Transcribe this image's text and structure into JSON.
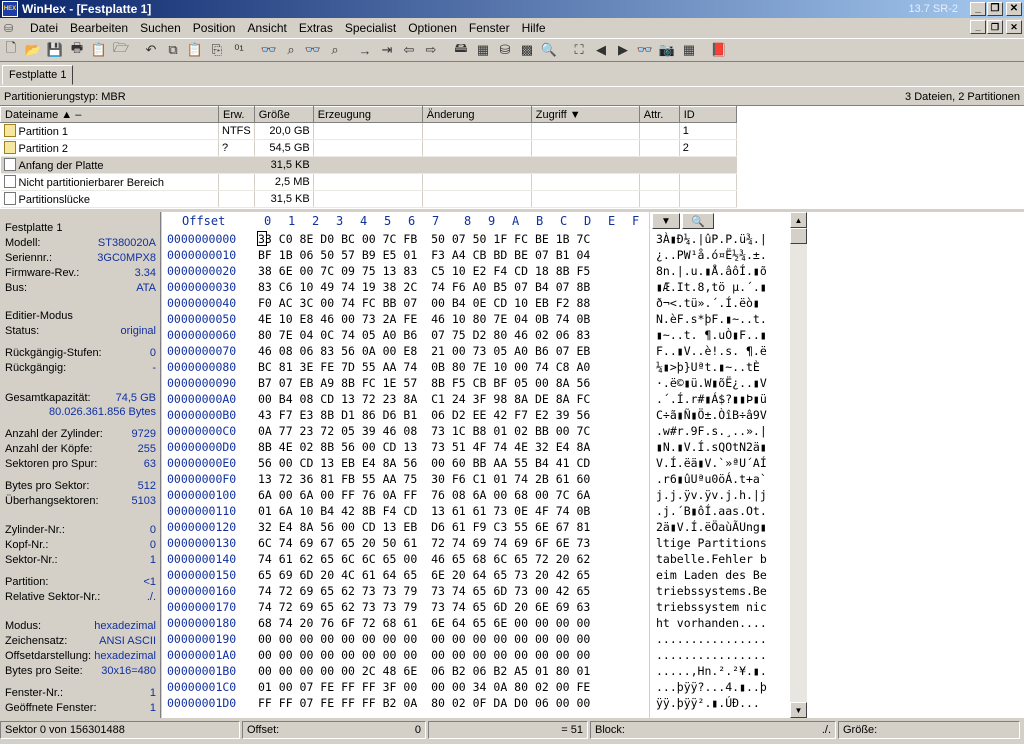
{
  "window": {
    "app_icon_text": "HEX",
    "title": "WinHex - [Festplatte 1]",
    "version": "13.7 SR-2",
    "buttons": [
      "_",
      "❐",
      "✕"
    ]
  },
  "menu": {
    "items": [
      "Datei",
      "Bearbeiten",
      "Suchen",
      "Position",
      "Ansicht",
      "Extras",
      "Specialist",
      "Optionen",
      "Fenster",
      "Hilfe"
    ],
    "mdi_buttons": [
      "_",
      "❐",
      "✕"
    ]
  },
  "toolbar": {
    "icons": [
      {
        "name": "new-icon",
        "glyph": "🗋"
      },
      {
        "name": "open-icon",
        "glyph": "📂"
      },
      {
        "name": "save-icon",
        "glyph": "💾"
      },
      {
        "name": "print-icon",
        "glyph": "🖶"
      },
      {
        "name": "properties-icon",
        "glyph": "📋"
      },
      {
        "name": "open-folder-icon",
        "glyph": "🗁"
      },
      {
        "name": "sep",
        "glyph": ""
      },
      {
        "name": "undo-icon",
        "glyph": "↶"
      },
      {
        "name": "copy-icon",
        "glyph": "⧉"
      },
      {
        "name": "paste-icon",
        "glyph": "📋"
      },
      {
        "name": "paste-special-icon",
        "glyph": "⎘"
      },
      {
        "name": "copy-hex-icon",
        "glyph": "⁰¹"
      },
      {
        "name": "sep",
        "glyph": ""
      },
      {
        "name": "find-text-icon",
        "glyph": "👓"
      },
      {
        "name": "find-hex-icon",
        "glyph": "⌕"
      },
      {
        "name": "replace-text-icon",
        "glyph": "👓"
      },
      {
        "name": "replace-hex-icon",
        "glyph": "⌕"
      },
      {
        "name": "sep",
        "glyph": ""
      },
      {
        "name": "goto-offset-icon",
        "glyph": "→"
      },
      {
        "name": "goto-sector-icon",
        "glyph": "⇥"
      },
      {
        "name": "back-icon",
        "glyph": "⇦"
      },
      {
        "name": "forward-icon",
        "glyph": "⇨"
      },
      {
        "name": "sep",
        "glyph": ""
      },
      {
        "name": "disk-editor-icon",
        "glyph": "🖴"
      },
      {
        "name": "ram-editor-icon",
        "glyph": "▦"
      },
      {
        "name": "disk-clone-icon",
        "glyph": "⛁"
      },
      {
        "name": "calculator-icon",
        "glyph": "▩"
      },
      {
        "name": "search-icon",
        "glyph": "🔍"
      },
      {
        "name": "sep",
        "glyph": ""
      },
      {
        "name": "binoculars-icon",
        "glyph": "⛶"
      },
      {
        "name": "prev-icon",
        "glyph": "◀"
      },
      {
        "name": "next-icon",
        "glyph": "▶"
      },
      {
        "name": "find-next-icon",
        "glyph": "👓"
      },
      {
        "name": "snapshot-icon",
        "glyph": "📷"
      },
      {
        "name": "grid-icon",
        "glyph": "▦"
      },
      {
        "name": "sep",
        "glyph": ""
      },
      {
        "name": "help-book-icon",
        "glyph": "📕"
      }
    ]
  },
  "tabs": [
    {
      "label": "Festplatte 1"
    }
  ],
  "infobar": {
    "left": "Partitionierungstyp: MBR",
    "right": "3 Dateien, 2 Partitionen"
  },
  "filelist": {
    "columns": [
      "Dateiname ▲ –",
      "Erw.",
      "Größe",
      "Erzeugung",
      "Änderung",
      "Zugriff ▼",
      "Attr.",
      "ID"
    ],
    "rows": [
      {
        "name": "Partition 1",
        "ext": "NTFS",
        "size": "20,0 GB",
        "created": "",
        "modified": "",
        "accessed": "",
        "attr": "",
        "id": "1",
        "icon": "part"
      },
      {
        "name": "Partition 2",
        "ext": "?",
        "size": "54,5 GB",
        "created": "",
        "modified": "",
        "accessed": "",
        "attr": "",
        "id": "2",
        "icon": "part"
      },
      {
        "name": "Anfang der Platte",
        "ext": "",
        "size": "31,5 KB",
        "created": "",
        "modified": "",
        "accessed": "",
        "attr": "",
        "id": "",
        "icon": "file",
        "selected": true
      },
      {
        "name": "Nicht partitionierbarer Bereich",
        "ext": "",
        "size": "2,5 MB",
        "created": "",
        "modified": "",
        "accessed": "",
        "attr": "",
        "id": "",
        "icon": "file"
      },
      {
        "name": "Partitionslücke",
        "ext": "",
        "size": "31,5 KB",
        "created": "",
        "modified": "",
        "accessed": "",
        "attr": "",
        "id": "",
        "icon": "file"
      }
    ]
  },
  "info_panel": [
    {
      "label": "Festplatte 1",
      "value": ""
    },
    {
      "label": "Modell:",
      "value": "ST380020A"
    },
    {
      "label": "Seriennr.:",
      "value": "3GC0MPX8"
    },
    {
      "label": "Firmware-Rev.:",
      "value": "3.34"
    },
    {
      "label": "Bus:",
      "value": "ATA"
    },
    {
      "label": "Editier-Modus",
      "value": ""
    },
    {
      "label": "Status:",
      "value": "original"
    },
    {
      "label": "Rückgängig-Stufen:",
      "value": "0"
    },
    {
      "label": "Rückgängig:",
      "value": "-"
    },
    {
      "label": "Gesamtkapazität:",
      "value": "74,5 GB"
    },
    {
      "label": "",
      "value": "80.026.361.856 Bytes"
    },
    {
      "label": "Anzahl der Zylinder:",
      "value": "9729"
    },
    {
      "label": "Anzahl der Köpfe:",
      "value": "255"
    },
    {
      "label": "Sektoren pro Spur:",
      "value": "63"
    },
    {
      "label": "Bytes pro Sektor:",
      "value": "512"
    },
    {
      "label": "Überhangsektoren:",
      "value": "5103"
    },
    {
      "label": "Zylinder-Nr.:",
      "value": "0"
    },
    {
      "label": "Kopf-Nr.:",
      "value": "0"
    },
    {
      "label": "Sektor-Nr.:",
      "value": "1"
    },
    {
      "label": "Partition:",
      "value": "<1"
    },
    {
      "label": "Relative Sektor-Nr.:",
      "value": "./."
    },
    {
      "label": "Modus:",
      "value": "hexadezimal"
    },
    {
      "label": "Zeichensatz:",
      "value": "ANSI ASCII"
    },
    {
      "label": "Offsetdarstellung:",
      "value": "hexadezimal"
    },
    {
      "label": "Bytes pro Seite:",
      "value": "30x16=480"
    },
    {
      "label": "Fenster-Nr.:",
      "value": "1"
    },
    {
      "label": "Geöffnete Fenster:",
      "value": "1"
    }
  ],
  "hex": {
    "header_offset": "Offset",
    "header_cols": [
      "0",
      "1",
      "2",
      "3",
      "4",
      "5",
      "6",
      "7",
      "8",
      "9",
      "A",
      "B",
      "C",
      "D",
      "E",
      "F"
    ],
    "rows": [
      {
        "offset": "0000000000",
        "bytes": "33 C0 8E D0 BC 00 7C FB  50 07 50 1F FC BE 1B 7C",
        "ascii": "3À▮Ð¼.|ûP.P.ü¾.|"
      },
      {
        "offset": "0000000010",
        "bytes": "BF 1B 06 50 57 B9 E5 01  F3 A4 CB BD BE 07 B1 04",
        "ascii": "¿..PW¹å.ó¤Ë½¾.±."
      },
      {
        "offset": "0000000020",
        "bytes": "38 6E 00 7C 09 75 13 83  C5 10 E2 F4 CD 18 8B F5",
        "ascii": "8n.|.u.▮Å.âôÍ.▮õ"
      },
      {
        "offset": "0000000030",
        "bytes": "83 C6 10 49 74 19 38 2C  74 F6 A0 B5 07 B4 07 8B",
        "ascii": "▮Æ.It.8,tö µ.´.▮"
      },
      {
        "offset": "0000000040",
        "bytes": "F0 AC 3C 00 74 FC BB 07  00 B4 0E CD 10 EB F2 88",
        "ascii": "ð¬<.tü».´.Í.ëò▮"
      },
      {
        "offset": "0000000050",
        "bytes": "4E 10 E8 46 00 73 2A FE  46 10 80 7E 04 0B 74 0B",
        "ascii": "N.èF.s*þF.▮~..t."
      },
      {
        "offset": "0000000060",
        "bytes": "80 7E 04 0C 74 05 A0 B6  07 75 D2 80 46 02 06 83",
        "ascii": "▮~..t. ¶.uÒ▮F..▮"
      },
      {
        "offset": "0000000070",
        "bytes": "46 08 06 83 56 0A 00 E8  21 00 73 05 A0 B6 07 EB",
        "ascii": "F..▮V..è!.s. ¶.ë"
      },
      {
        "offset": "0000000080",
        "bytes": "BC 81 3E FE 7D 55 AA 74  0B 80 7E 10 00 74 C8 A0",
        "ascii": "¼▮>þ}Uªt.▮~..tÈ "
      },
      {
        "offset": "0000000090",
        "bytes": "B7 07 EB A9 8B FC 1E 57  8B F5 CB BF 05 00 8A 56",
        "ascii": "·.ë©▮ü.W▮õË¿..▮V"
      },
      {
        "offset": "00000000A0",
        "bytes": "00 B4 08 CD 13 72 23 8A  C1 24 3F 98 8A DE 8A FC",
        "ascii": ".´.Í.r#▮Á$?▮▮Þ▮ü"
      },
      {
        "offset": "00000000B0",
        "bytes": "43 F7 E3 8B D1 86 D6 B1  06 D2 EE 42 F7 E2 39 56",
        "ascii": "C÷ã▮Ñ▮Ö±.ÒîB÷â9V"
      },
      {
        "offset": "00000000C0",
        "bytes": "0A 77 23 72 05 39 46 08  73 1C B8 01 02 BB 00 7C",
        "ascii": ".w#r.9F.s.¸..».|"
      },
      {
        "offset": "00000000D0",
        "bytes": "8B 4E 02 8B 56 00 CD 13  73 51 4F 74 4E 32 E4 8A",
        "ascii": "▮N.▮V.Í.sQOtN2ä▮"
      },
      {
        "offset": "00000000E0",
        "bytes": "56 00 CD 13 EB E4 8A 56  00 60 BB AA 55 B4 41 CD",
        "ascii": "V.Í.ëä▮V.`»ªU´AÍ"
      },
      {
        "offset": "00000000F0",
        "bytes": "13 72 36 81 FB 55 AA 75  30 F6 C1 01 74 2B 61 60",
        "ascii": ".r6▮ûUªu0öÁ.t+a`"
      },
      {
        "offset": "0000000100",
        "bytes": "6A 00 6A 00 FF 76 0A FF  76 08 6A 00 68 00 7C 6A",
        "ascii": "j.j.ÿv.ÿv.j.h.|j"
      },
      {
        "offset": "0000000110",
        "bytes": "01 6A 10 B4 42 8B F4 CD  13 61 61 73 0E 4F 74 0B",
        "ascii": ".j.´B▮ôÍ.aas.Ot."
      },
      {
        "offset": "0000000120",
        "bytes": "32 E4 8A 56 00 CD 13 EB  D6 61 F9 C3 55 6E 67 81",
        "ascii": "2ä▮V.Í.ëÖaùÃUng▮"
      },
      {
        "offset": "0000000130",
        "bytes": "6C 74 69 67 65 20 50 61  72 74 69 74 69 6F 6E 73",
        "ascii": "ltige Partitions"
      },
      {
        "offset": "0000000140",
        "bytes": "74 61 62 65 6C 6C 65 00  46 65 68 6C 65 72 20 62",
        "ascii": "tabelle.Fehler b"
      },
      {
        "offset": "0000000150",
        "bytes": "65 69 6D 20 4C 61 64 65  6E 20 64 65 73 20 42 65",
        "ascii": "eim Laden des Be"
      },
      {
        "offset": "0000000160",
        "bytes": "74 72 69 65 62 73 73 79  73 74 65 6D 73 00 42 65",
        "ascii": "triebssystems.Be"
      },
      {
        "offset": "0000000170",
        "bytes": "74 72 69 65 62 73 73 79  73 74 65 6D 20 6E 69 63",
        "ascii": "triebssystem nic"
      },
      {
        "offset": "0000000180",
        "bytes": "68 74 20 76 6F 72 68 61  6E 64 65 6E 00 00 00 00",
        "ascii": "ht vorhanden...."
      },
      {
        "offset": "0000000190",
        "bytes": "00 00 00 00 00 00 00 00  00 00 00 00 00 00 00 00",
        "ascii": "................"
      },
      {
        "offset": "00000001A0",
        "bytes": "00 00 00 00 00 00 00 00  00 00 00 00 00 00 00 00",
        "ascii": "................"
      },
      {
        "offset": "00000001B0",
        "bytes": "00 00 00 00 00 2C 48 6E  06 B2 06 B2 A5 01 80 01",
        "ascii": ".....,Hn.².²¥.▮."
      },
      {
        "offset": "00000001C0",
        "bytes": "01 00 07 FE FF FF 3F 00  00 00 34 0A 80 02 00 FE",
        "ascii": "...þÿÿ?...4.▮..þ"
      },
      {
        "offset": "00000001D0",
        "bytes": "FF FF 07 FE FF FF B2 0A  80 02 0F DA D0 06 00 00",
        "ascii": "ÿÿ.þÿÿ².▮.ÚÐ..."
      }
    ]
  },
  "statusbar": {
    "sector": "Sektor 0 von 156301488",
    "offset_label": "Offset:",
    "offset_value": "0",
    "eq_value": "= 51",
    "block_label": "Block:",
    "block_value": "./.",
    "size_label": "Größe:"
  }
}
